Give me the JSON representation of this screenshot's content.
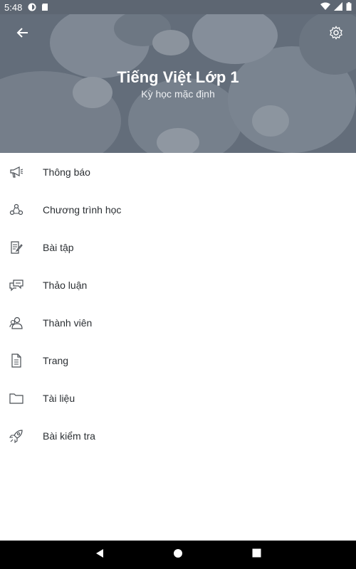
{
  "status_bar": {
    "time": "5:48",
    "icons": [
      "notification-icon",
      "sd-card-icon",
      "wifi-icon",
      "signal-icon",
      "battery-icon"
    ]
  },
  "header": {
    "title": "Tiếng Việt Lớp 1",
    "subtitle": "Kỳ học mặc định",
    "back_icon": "arrow-back-icon",
    "settings_icon": "gear-icon"
  },
  "menu": {
    "items": [
      {
        "label": "Thông báo",
        "icon": "megaphone-icon"
      },
      {
        "label": "Chương trình học",
        "icon": "modules-icon"
      },
      {
        "label": "Bài tập",
        "icon": "assignment-icon"
      },
      {
        "label": "Thảo luận",
        "icon": "discussion-icon"
      },
      {
        "label": "Thành viên",
        "icon": "people-icon"
      },
      {
        "label": "Trang",
        "icon": "page-icon"
      },
      {
        "label": "Tài liệu",
        "icon": "folder-icon"
      },
      {
        "label": "Bài kiểm tra",
        "icon": "rocket-icon"
      }
    ]
  },
  "nav_bar": {
    "buttons": [
      "back-triangle-icon",
      "home-circle-icon",
      "recents-square-icon"
    ]
  },
  "colors": {
    "status_bar": "#5d6672",
    "header_overlay": "#5f6976",
    "text": "#2b2f33",
    "icon": "#4a4f55"
  }
}
